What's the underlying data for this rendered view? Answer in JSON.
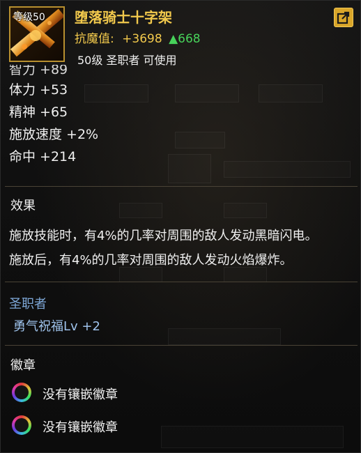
{
  "item": {
    "level_tag": "等级50",
    "name": "堕落骑士十字架",
    "magic_resist_label": "抗魔值:",
    "magic_resist_value": "+3698",
    "magic_resist_up_icon": "▲",
    "magic_resist_up": "668",
    "requirement": "50级 圣职者 可使用"
  },
  "stats": [
    "智力 +89",
    "体力 +53",
    "精神 +65",
    "施放速度 +2%",
    "命中 +214"
  ],
  "effect": {
    "title": "效果",
    "lines": [
      "施放技能时，有4%的几率对周围的敌人发动黑暗闪电。",
      "施放后，有4%的几率对周围的敌人发动火焰爆炸。"
    ]
  },
  "class_bonus": {
    "title": "圣职者",
    "skill": "勇气祝福Lv +2"
  },
  "badges": {
    "title": "徽章",
    "slots": [
      "没有镶嵌徽章",
      "没有镶嵌徽章"
    ]
  },
  "colors": {
    "gold": "#f2c94c",
    "green_up": "#47d25a",
    "class_blue": "#7ea8d8"
  },
  "icons": {
    "share": "share-icon",
    "item": "cross-weapon-icon",
    "badge": "badge-slot-icon"
  }
}
